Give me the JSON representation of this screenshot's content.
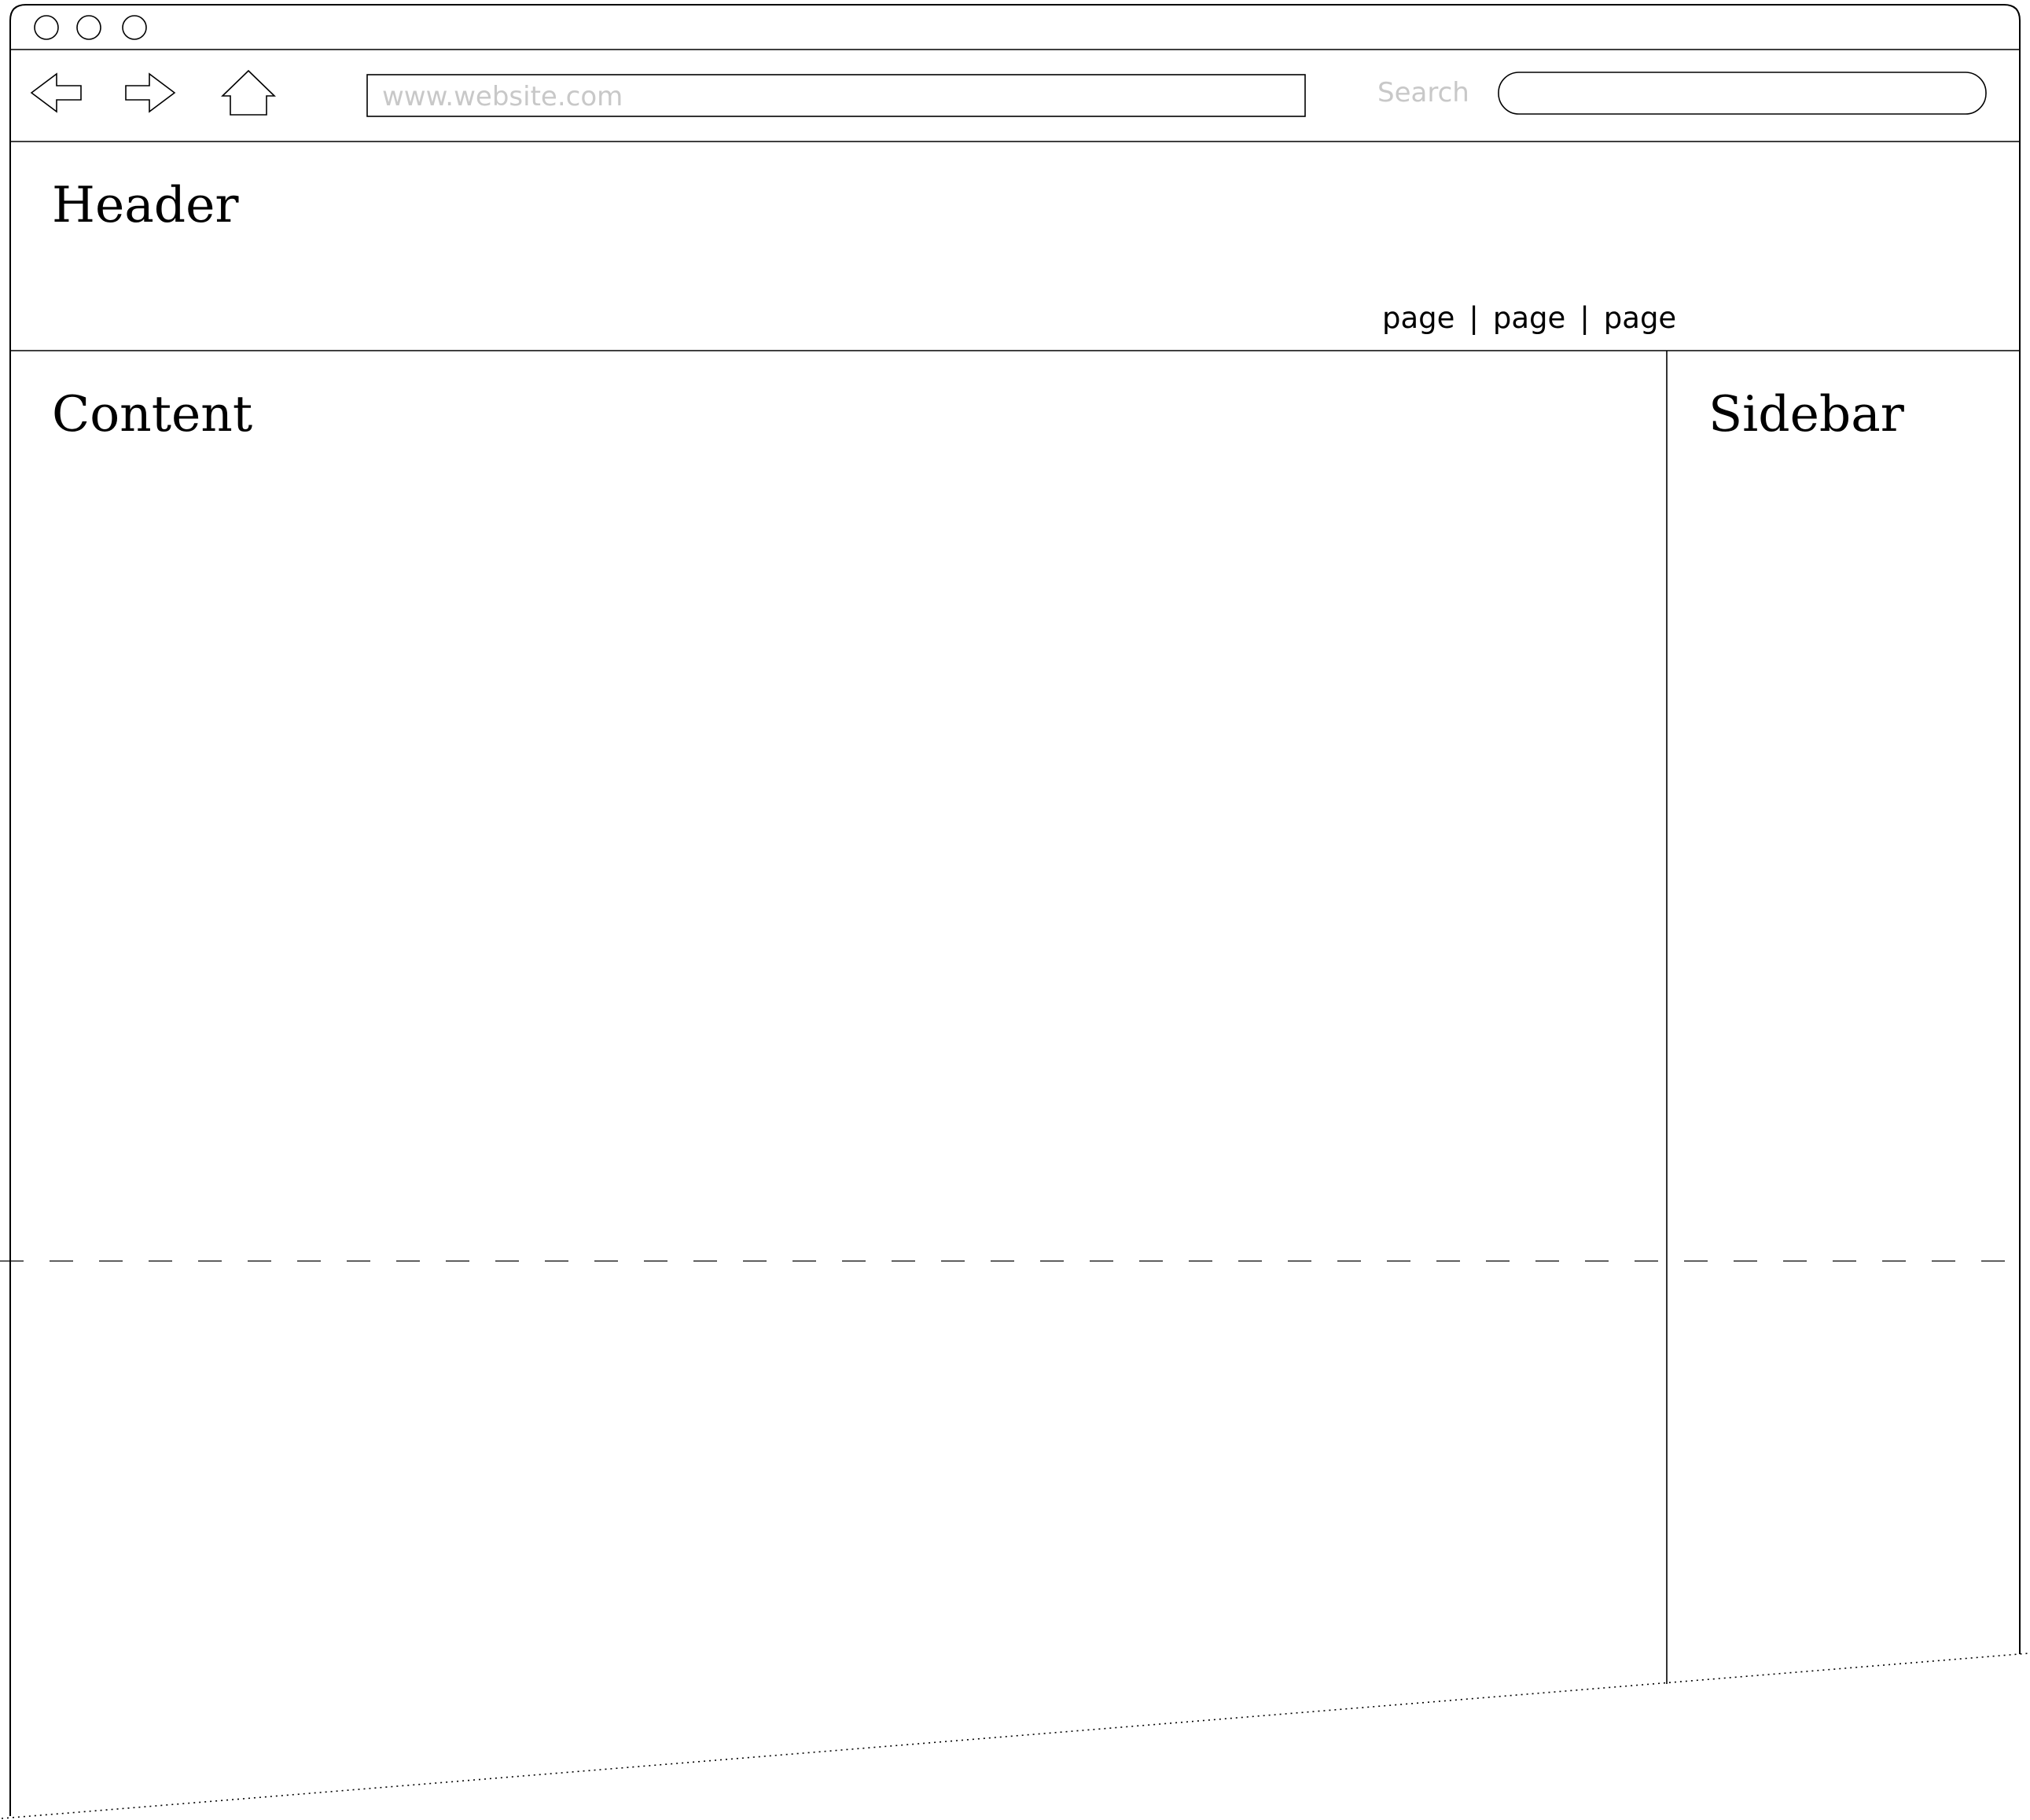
{
  "browser": {
    "window_controls": [
      "close",
      "minimize",
      "maximize"
    ],
    "toolbar": {
      "back_icon": "arrow-left-icon",
      "forward_icon": "arrow-right-icon",
      "home_icon": "home-icon",
      "url_value": "www.website.com",
      "search_label": "Search",
      "search_value": ""
    }
  },
  "page": {
    "header": {
      "title": "Header",
      "nav_links": [
        "page",
        "page",
        "page"
      ],
      "separator": "|"
    },
    "content": {
      "title": "Content"
    },
    "sidebar": {
      "title": "Sidebar"
    },
    "fold_line": "dashed"
  },
  "colors": {
    "stroke": "#000000",
    "placeholder_text": "#c8c8c8",
    "background": "#ffffff"
  }
}
